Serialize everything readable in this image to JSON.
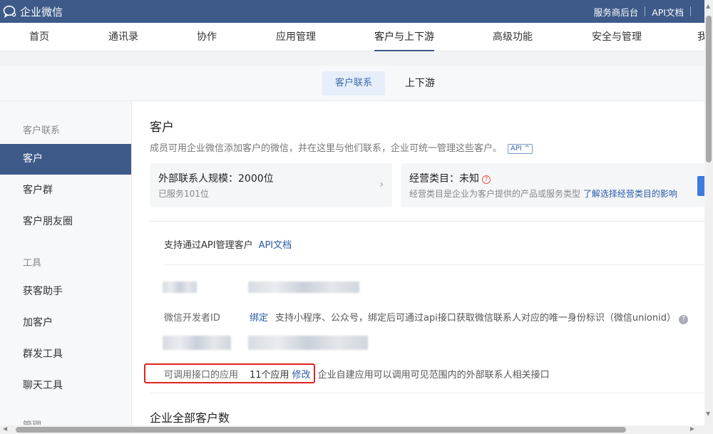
{
  "app": {
    "title": "企业微信"
  },
  "top_links": [
    "服务商后台",
    "API文档"
  ],
  "nav": {
    "items": [
      "首页",
      "通讯录",
      "协作",
      "应用管理",
      "客户与上下游",
      "高级功能",
      "安全与管理",
      "我"
    ],
    "active": "客户与上下游"
  },
  "subtabs": [
    "客户联系",
    "上下游"
  ],
  "sidebar": {
    "group1": "客户联系",
    "items1": [
      "客户",
      "客户群",
      "客户朋友圈"
    ],
    "group2": "工具",
    "items2": [
      "获客助手",
      "加客户",
      "群发工具",
      "聊天工具"
    ],
    "group3_cut": "管理"
  },
  "main": {
    "title": "客户",
    "desc": "成员可用企业微信添加客户的微信，并在这里与他们联系，企业可统一管理这些客户。",
    "api_tag": "API ^",
    "card1": {
      "title": "外部联系人规模：2000位",
      "sub": "已服务101位"
    },
    "card2": {
      "title": "经营类目：未知",
      "sub": "经营类目是企业为客户提供的产品或服务类型",
      "link": "了解选择经营类目的影响"
    },
    "api_manage": "支持通过API管理客户",
    "api_doc": "API文档",
    "dev_id": {
      "label": "微信开发者ID",
      "link": "绑定",
      "desc": "支持小程序、公众号，绑定后可通过api接口获取微信联系人对应的唯一身份标识（微信unionid）"
    },
    "apps": {
      "label": "可调用接口的应用",
      "count": "11个应用",
      "edit": "修改",
      "desc": "企业自建应用可以调用可见范围内的外部联系人相关接口"
    },
    "total_title": "企业全部客户数"
  },
  "colors": {
    "brand": "#3d5a89",
    "link": "#2b5aa8",
    "highlight_box": "#e0241f"
  }
}
